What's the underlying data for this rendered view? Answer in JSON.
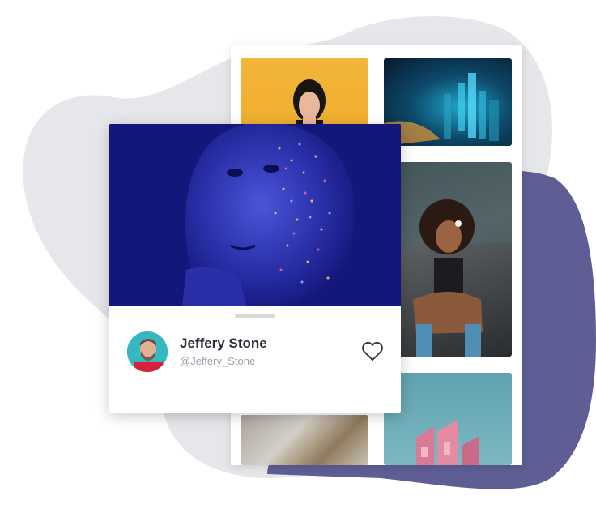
{
  "profile": {
    "name": "Jeffery Stone",
    "username": "@Jeffery_Stone"
  },
  "icons": {
    "like": "heart-outline-icon"
  },
  "colors": {
    "blob_gray": "#e6e7ea",
    "blob_purple": "#5e5e94",
    "hero_blue": "#13177a",
    "name_text": "#2b2f3a",
    "username_text": "#9b9fae"
  }
}
